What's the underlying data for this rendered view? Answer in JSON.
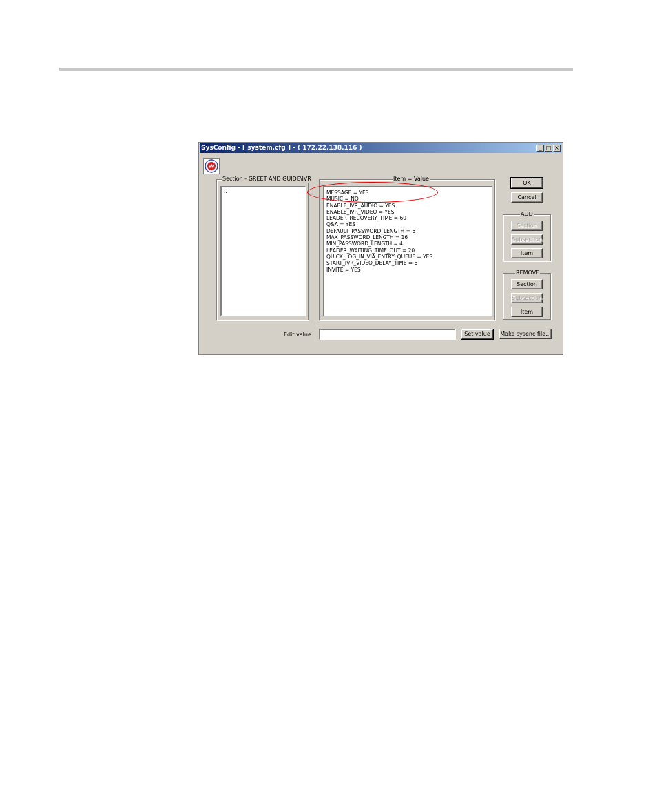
{
  "window": {
    "title": "SysConfig - [ system.cfg ] - ( 172.22.138.116 )",
    "min_label": "_",
    "max_label": "□",
    "close_label": "×"
  },
  "section_panel": {
    "label": "Section - GREET AND GUIDE\\IVR",
    "items": [
      ".."
    ]
  },
  "items_panel": {
    "label": "Item = Value",
    "items": [
      "MESSAGE = YES",
      "MUSIC = NO",
      "ENABLE_IVR_AUDIO = YES",
      "ENABLE_IVR_VIDEO = YES",
      "LEADER_RECOVERY_TIME = 60",
      "Q&A = YES",
      "DEFAULT_PASSWORD_LENGTH = 6",
      "MAX_PASSWORD_LENGTH = 16",
      "MIN_PASSWORD_LENGTH = 4",
      "LEADER_WAITING_TIME_OUT = 20",
      "QUICK_LOG_IN_VIA_ENTRY_QUEUE = YES",
      "START_IVR_VIDEO_DELAY_TIME = 6",
      "INVITE = YES"
    ]
  },
  "buttons": {
    "ok": "OK",
    "cancel": "Cancel",
    "add_group": "ADD",
    "add_section": "Section",
    "add_subsection": "Subsection",
    "add_item": "Item",
    "remove_group": "REMOVE",
    "remove_section": "Section",
    "remove_subsection": "Subsection",
    "remove_item": "Item",
    "set_value": "Set value",
    "make_sysenc": "Make sysenc file..."
  },
  "edit": {
    "label": "Edit value",
    "value": ""
  },
  "colors": {
    "annotation": "#e00000",
    "titlebar_start": "#0a246a",
    "titlebar_end": "#a6caf0"
  }
}
